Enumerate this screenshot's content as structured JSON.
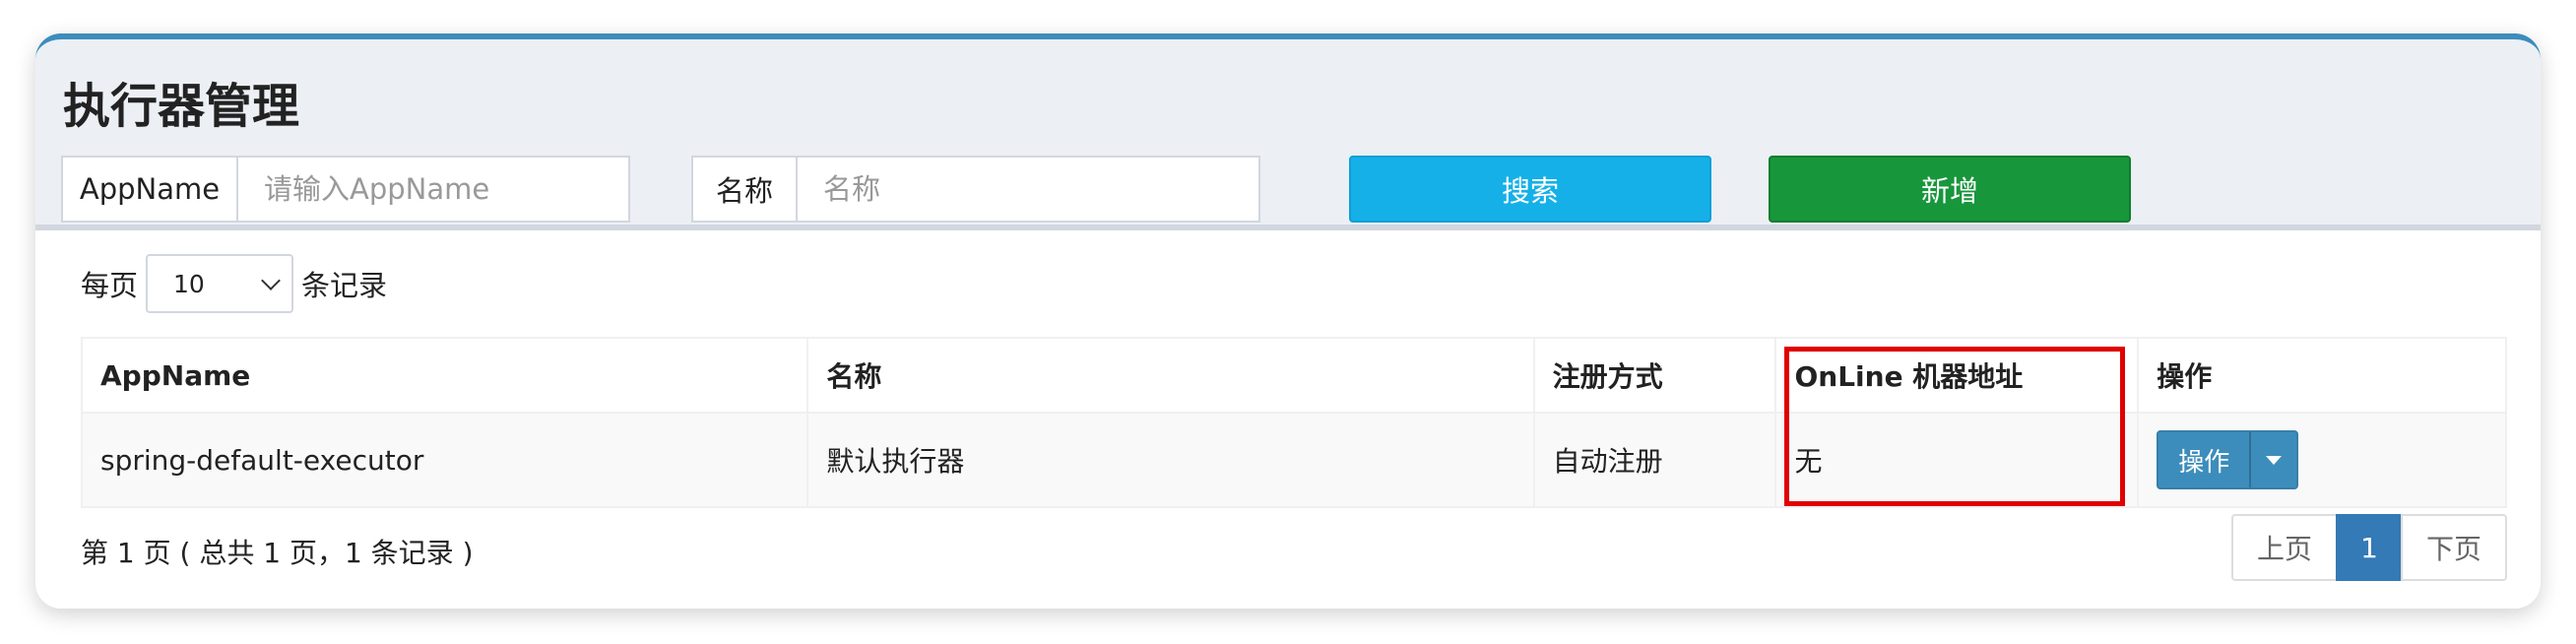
{
  "page": {
    "title": "执行器管理"
  },
  "search": {
    "appname_label": "AppName",
    "appname_placeholder": "请输入AppName",
    "name_label": "名称",
    "name_placeholder": "名称",
    "search_button": "搜索",
    "add_button": "新增"
  },
  "length": {
    "prefix": "每页",
    "value": "10",
    "suffix": "条记录"
  },
  "table": {
    "headers": [
      "AppName",
      "名称",
      "注册方式",
      "OnLine 机器地址",
      "操作"
    ],
    "rows": [
      {
        "appname": "spring-default-executor",
        "name": "默认执行器",
        "reg_type": "自动注册",
        "online": "无",
        "action": "操作"
      }
    ]
  },
  "footer": {
    "info": "第 1 页 ( 总共 1 页，1 条记录 )",
    "prev": "上页",
    "current": "1",
    "next": "下页"
  },
  "colors": {
    "accent": "#3c8dbc",
    "search_button": "#15b0e8",
    "add_button": "#17963c",
    "highlight": "#e00000"
  }
}
